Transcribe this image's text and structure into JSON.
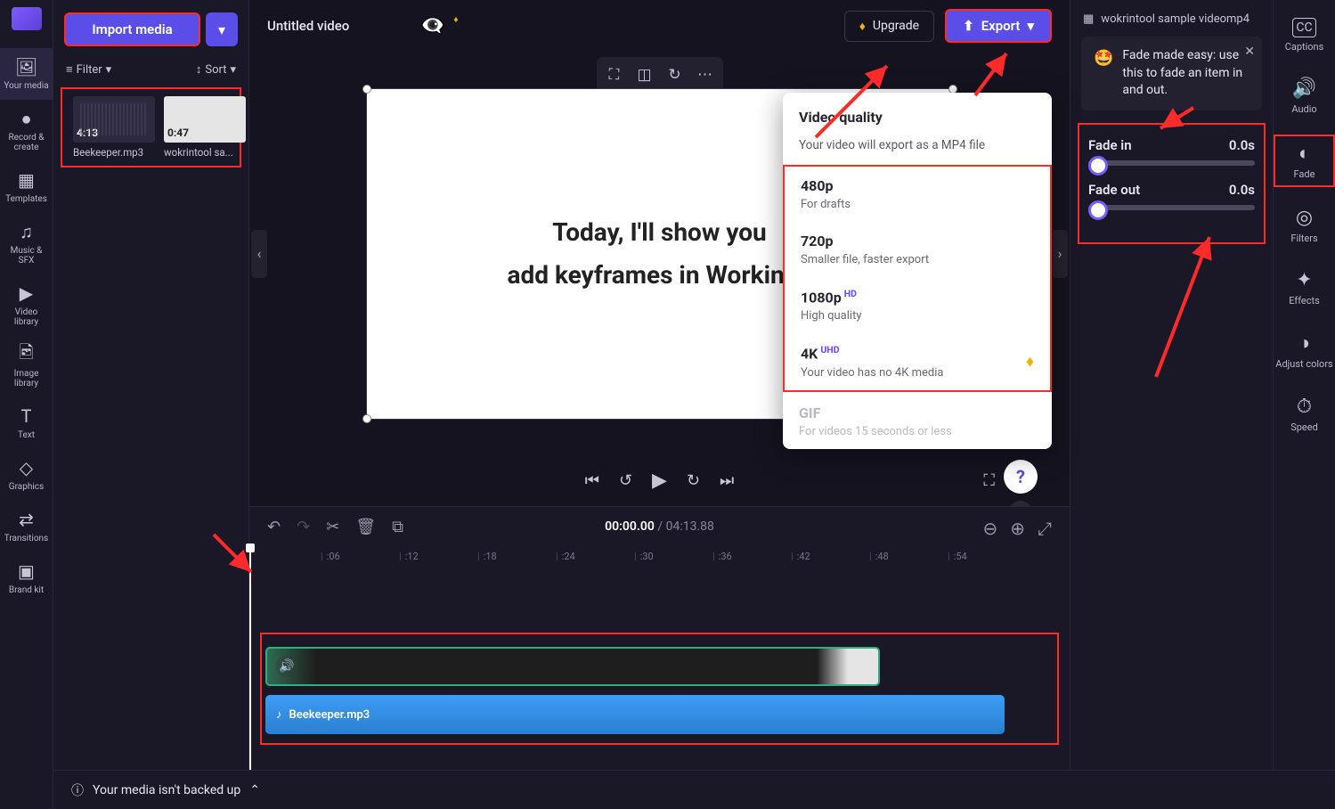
{
  "left_nav": {
    "items": [
      {
        "label": "Your media",
        "icon": "🖼"
      },
      {
        "label": "Record & create",
        "icon": "●"
      },
      {
        "label": "Templates",
        "icon": "▦"
      },
      {
        "label": "Music & SFX",
        "icon": "♫"
      },
      {
        "label": "Video library",
        "icon": "▶"
      },
      {
        "label": "Image library",
        "icon": "🖻"
      },
      {
        "label": "Text",
        "icon": "T"
      },
      {
        "label": "Graphics",
        "icon": "◇"
      },
      {
        "label": "Transitions",
        "icon": "⇄"
      },
      {
        "label": "Brand kit",
        "icon": "▣"
      }
    ]
  },
  "media_panel": {
    "import_label": "Import media",
    "filter_label": "Filter",
    "sort_label": "Sort",
    "thumbs": [
      {
        "name": "Beekeeper.mp3",
        "dur": "4:13"
      },
      {
        "name": "wokrintool sa...",
        "dur": "0:47"
      }
    ]
  },
  "top": {
    "title": "Untitled video",
    "upgrade": "Upgrade",
    "export": "Export"
  },
  "preview": {
    "text_line1": "Today, I'll show you",
    "text_line2": "add keyframes in WorkinTo"
  },
  "export_popup": {
    "title": "Video quality",
    "subtitle": "Your video will export as a MP4 file",
    "options": [
      {
        "label": "480p",
        "sub": "For drafts",
        "badge": ""
      },
      {
        "label": "720p",
        "sub": "Smaller file, faster export",
        "badge": ""
      },
      {
        "label": "1080p",
        "sub": "High quality",
        "badge": "HD"
      },
      {
        "label": "4K",
        "sub": "Your video has no 4K media",
        "badge": "UHD",
        "premium": true
      }
    ],
    "gif_label": "GIF",
    "gif_sub": "For videos 15 seconds or less"
  },
  "timeline": {
    "current": "00:00.00",
    "total": "04:13.88",
    "ticks": [
      ":06",
      ":12",
      ":18",
      ":24",
      ":30",
      ":36",
      ":42",
      ":48",
      ":54"
    ],
    "audio_track": "Beekeeper.mp3"
  },
  "fade": {
    "header_name": "wokrintool sample videomp4",
    "tip": "Fade made easy: use this to fade an item in and out.",
    "fade_in_label": "Fade in",
    "fade_in_val": "0.0s",
    "fade_out_label": "Fade out",
    "fade_out_val": "0.0s"
  },
  "right_nav": {
    "items": [
      {
        "label": "Captions",
        "icon": "CC"
      },
      {
        "label": "Audio",
        "icon": "🔊"
      },
      {
        "label": "Fade",
        "icon": "◐"
      },
      {
        "label": "Filters",
        "icon": "◎"
      },
      {
        "label": "Effects",
        "icon": "✦"
      },
      {
        "label": "Adjust colors",
        "icon": "◑"
      },
      {
        "label": "Speed",
        "icon": "⏱"
      }
    ]
  },
  "status_bar": "Your media isn't backed up"
}
